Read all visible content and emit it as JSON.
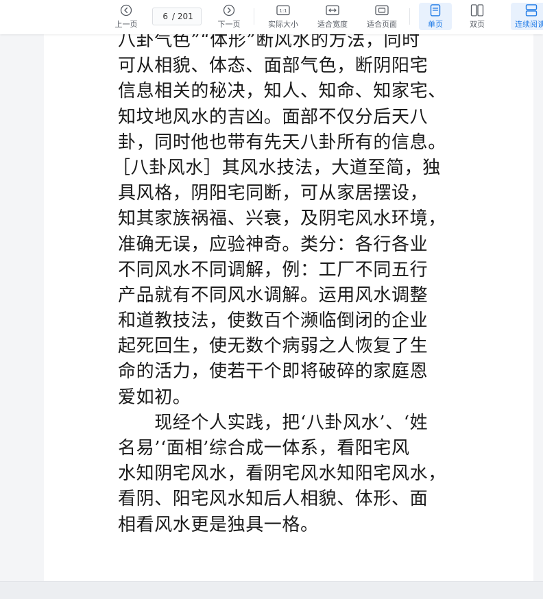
{
  "toolbar": {
    "prev_label": "上一页",
    "next_label": "下一页",
    "current_page": "6",
    "total_pages": "/ 201",
    "actual_size_label": "实际大小",
    "fit_width_label": "适合宽度",
    "fit_page_label": "适合页面",
    "single_page_label": "单页",
    "double_page_label": "双页",
    "continuous_label": "连续阅读",
    "actual_size_icon_text": "1:1"
  },
  "colors": {
    "accent": "#1e7ae6",
    "active_bg": "#e8f1fd"
  },
  "document": {
    "lines": [
      "八卦气色”“体形”断风水的方法，同时",
      "可从相貌、体态、面部气色，断阴阳宅",
      "信息相关的秘决，知人、知命、知家宅、",
      "知坟地风水的吉凶。面部不仅分后天八",
      "卦，同时他也带有先天八卦所有的信息。",
      "［八卦风水］其风水技法，大道至简，独",
      "具风格，阴阳宅同断，可从家居摆设，",
      "知其家族祸福、兴衰，及阴宅风水环境，",
      "准确无误，应验神奇。类分：各行各业",
      "不同风水不同调解，例：工厂不同五行",
      "产品就有不同风水调解。运用风水调整",
      "和道教技法，使数百个濒临倒闭的企业",
      "起死回生，使无数个病弱之人恢复了生",
      "命的活力，使若干个即将破碎的家庭恩",
      "爱如初。",
      "　　现经个人实践，把‘八卦风水’、‘姓",
      "名易’‘面相’综合成一体系，看阳宅风",
      "水知阴宅风水，看阴宅风水知阳宅风水，",
      "看阴、阳宅风水知后人相貌、体形、面",
      "相看风水更是独具一格。"
    ]
  }
}
